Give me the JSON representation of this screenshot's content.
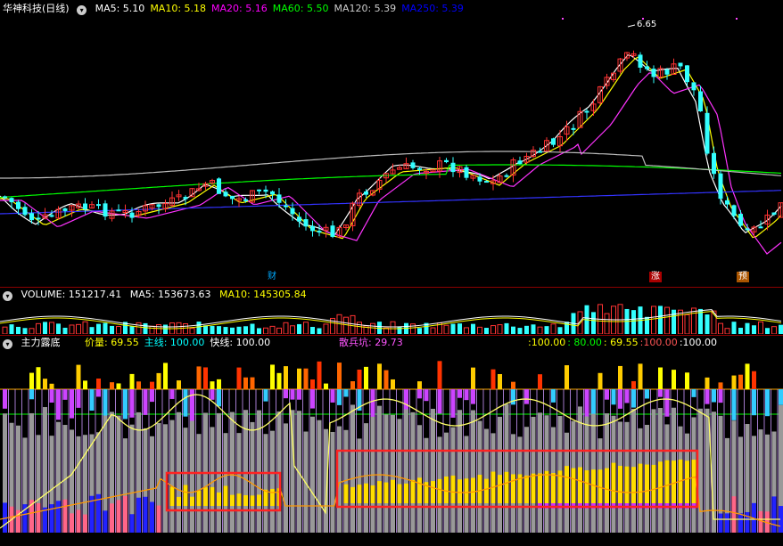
{
  "main": {
    "title": "华神科技(日线)",
    "ma": [
      {
        "label": "MA5: 5.10",
        "color": "#ffffff"
      },
      {
        "label": "MA10: 5.18",
        "color": "#ffff00"
      },
      {
        "label": "MA20: 5.16",
        "color": "#ff00ff"
      },
      {
        "label": "MA60: 5.50",
        "color": "#00ff00"
      },
      {
        "label": "MA120: 5.39",
        "color": "#cccccc"
      },
      {
        "label": "MA250: 5.39",
        "color": "#0000ff"
      }
    ],
    "peak_label": "6.65",
    "markers": [
      {
        "text": "财",
        "bg": "#000000",
        "fg": "#00aaff"
      },
      {
        "text": "涨",
        "bg": "#aa0000",
        "fg": "#ffffff"
      },
      {
        "text": "预",
        "bg": "#aa5500",
        "fg": "#ffffff"
      }
    ]
  },
  "volume": {
    "label": "VOLUME: 151217.41",
    "ma5": "MA5: 153673.63",
    "ma10": "MA10: 145305.84"
  },
  "indicator": {
    "name": "主力露底",
    "items": [
      {
        "label": "价量: 69.55",
        "color": "#ffff00"
      },
      {
        "label": "主线: 100.00",
        "color": "#00ffff"
      },
      {
        "label": "快线: 100.00",
        "color": "#ffffff"
      }
    ],
    "retail": {
      "label": "散兵坑: 29.73",
      "color": "#ff55ff"
    },
    "right_values": [
      {
        "label": ":100.00",
        "color": "#ffff00"
      },
      {
        "label": ": 80.00",
        "color": "#00ff00"
      },
      {
        "label": ": 69.55",
        "color": "#ffff00"
      },
      {
        "label": ":100.00",
        "color": "#ff5555"
      },
      {
        "label": ":100.00",
        "color": "#ffffff"
      }
    ]
  }
}
